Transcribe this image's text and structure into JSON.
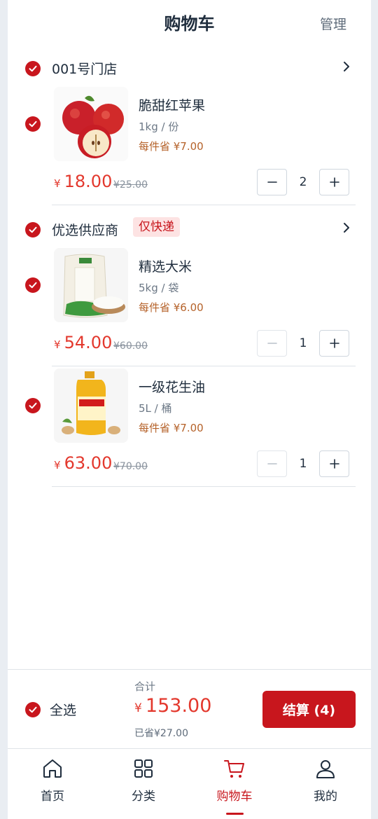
{
  "header": {
    "title": "购物车",
    "manage": "管理"
  },
  "stores": [
    {
      "name": "001号门店",
      "tag": "",
      "items": [
        {
          "name": "脆甜红苹果",
          "spec": "1kg / 份",
          "save": "每件省 ¥7.00",
          "currency": "¥",
          "price": "18.00",
          "original": "¥25.00",
          "qty": "2",
          "thumb": "apple-image"
        }
      ]
    },
    {
      "name": "优选供应商",
      "tag": "仅快递",
      "items": [
        {
          "name": "精选大米",
          "spec": "5kg / 袋",
          "save": "每件省 ¥6.00",
          "currency": "¥",
          "price": "54.00",
          "original": "¥60.00",
          "qty": "1",
          "thumb": "rice-bag-image"
        },
        {
          "name": "一级花生油",
          "spec": "5L / 桶",
          "save": "每件省 ¥7.00",
          "currency": "¥",
          "price": "63.00",
          "original": "¥70.00",
          "qty": "1",
          "thumb": "peanut-oil-image"
        }
      ]
    }
  ],
  "footer": {
    "select_all": "全选",
    "total_label": "合计",
    "currency": "¥",
    "total": "153.00",
    "saved": "已省¥27.00",
    "checkout": "结算 (4)"
  },
  "tabs": [
    {
      "label": "首页",
      "icon": "home-icon"
    },
    {
      "label": "分类",
      "icon": "grid-icon"
    },
    {
      "label": "购物车",
      "icon": "cart-icon",
      "active": true
    },
    {
      "label": "我的",
      "icon": "user-icon"
    }
  ],
  "colors": {
    "accent": "#c8161d",
    "price": "#e3382d",
    "saving": "#b5622a",
    "tag_bg": "#fde3e3"
  }
}
